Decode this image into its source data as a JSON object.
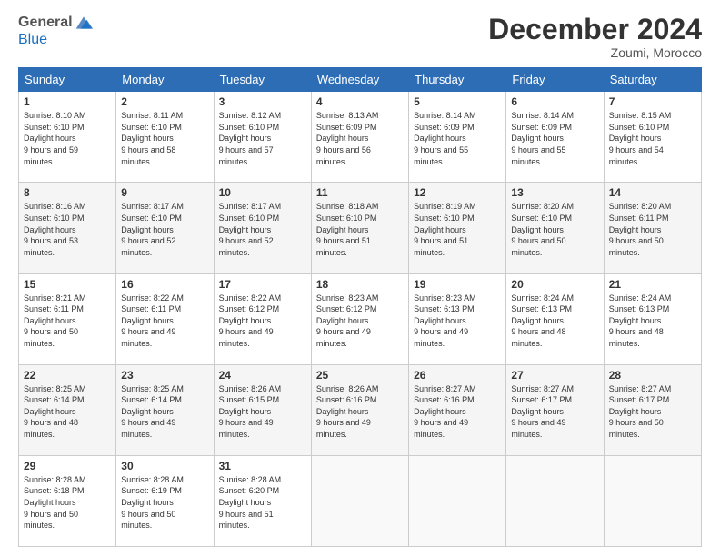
{
  "header": {
    "logo_general": "General",
    "logo_blue": "Blue",
    "month_title": "December 2024",
    "location": "Zoumi, Morocco"
  },
  "weekdays": [
    "Sunday",
    "Monday",
    "Tuesday",
    "Wednesday",
    "Thursday",
    "Friday",
    "Saturday"
  ],
  "weeks": [
    [
      {
        "day": "1",
        "sunrise": "8:10 AM",
        "sunset": "6:10 PM",
        "daylight": "9 hours and 59 minutes."
      },
      {
        "day": "2",
        "sunrise": "8:11 AM",
        "sunset": "6:10 PM",
        "daylight": "9 hours and 58 minutes."
      },
      {
        "day": "3",
        "sunrise": "8:12 AM",
        "sunset": "6:10 PM",
        "daylight": "9 hours and 57 minutes."
      },
      {
        "day": "4",
        "sunrise": "8:13 AM",
        "sunset": "6:09 PM",
        "daylight": "9 hours and 56 minutes."
      },
      {
        "day": "5",
        "sunrise": "8:14 AM",
        "sunset": "6:09 PM",
        "daylight": "9 hours and 55 minutes."
      },
      {
        "day": "6",
        "sunrise": "8:14 AM",
        "sunset": "6:09 PM",
        "daylight": "9 hours and 55 minutes."
      },
      {
        "day": "7",
        "sunrise": "8:15 AM",
        "sunset": "6:10 PM",
        "daylight": "9 hours and 54 minutes."
      }
    ],
    [
      {
        "day": "8",
        "sunrise": "8:16 AM",
        "sunset": "6:10 PM",
        "daylight": "9 hours and 53 minutes."
      },
      {
        "day": "9",
        "sunrise": "8:17 AM",
        "sunset": "6:10 PM",
        "daylight": "9 hours and 52 minutes."
      },
      {
        "day": "10",
        "sunrise": "8:17 AM",
        "sunset": "6:10 PM",
        "daylight": "9 hours and 52 minutes."
      },
      {
        "day": "11",
        "sunrise": "8:18 AM",
        "sunset": "6:10 PM",
        "daylight": "9 hours and 51 minutes."
      },
      {
        "day": "12",
        "sunrise": "8:19 AM",
        "sunset": "6:10 PM",
        "daylight": "9 hours and 51 minutes."
      },
      {
        "day": "13",
        "sunrise": "8:20 AM",
        "sunset": "6:10 PM",
        "daylight": "9 hours and 50 minutes."
      },
      {
        "day": "14",
        "sunrise": "8:20 AM",
        "sunset": "6:11 PM",
        "daylight": "9 hours and 50 minutes."
      }
    ],
    [
      {
        "day": "15",
        "sunrise": "8:21 AM",
        "sunset": "6:11 PM",
        "daylight": "9 hours and 50 minutes."
      },
      {
        "day": "16",
        "sunrise": "8:22 AM",
        "sunset": "6:11 PM",
        "daylight": "9 hours and 49 minutes."
      },
      {
        "day": "17",
        "sunrise": "8:22 AM",
        "sunset": "6:12 PM",
        "daylight": "9 hours and 49 minutes."
      },
      {
        "day": "18",
        "sunrise": "8:23 AM",
        "sunset": "6:12 PM",
        "daylight": "9 hours and 49 minutes."
      },
      {
        "day": "19",
        "sunrise": "8:23 AM",
        "sunset": "6:13 PM",
        "daylight": "9 hours and 49 minutes."
      },
      {
        "day": "20",
        "sunrise": "8:24 AM",
        "sunset": "6:13 PM",
        "daylight": "9 hours and 48 minutes."
      },
      {
        "day": "21",
        "sunrise": "8:24 AM",
        "sunset": "6:13 PM",
        "daylight": "9 hours and 48 minutes."
      }
    ],
    [
      {
        "day": "22",
        "sunrise": "8:25 AM",
        "sunset": "6:14 PM",
        "daylight": "9 hours and 48 minutes."
      },
      {
        "day": "23",
        "sunrise": "8:25 AM",
        "sunset": "6:14 PM",
        "daylight": "9 hours and 49 minutes."
      },
      {
        "day": "24",
        "sunrise": "8:26 AM",
        "sunset": "6:15 PM",
        "daylight": "9 hours and 49 minutes."
      },
      {
        "day": "25",
        "sunrise": "8:26 AM",
        "sunset": "6:16 PM",
        "daylight": "9 hours and 49 minutes."
      },
      {
        "day": "26",
        "sunrise": "8:27 AM",
        "sunset": "6:16 PM",
        "daylight": "9 hours and 49 minutes."
      },
      {
        "day": "27",
        "sunrise": "8:27 AM",
        "sunset": "6:17 PM",
        "daylight": "9 hours and 49 minutes."
      },
      {
        "day": "28",
        "sunrise": "8:27 AM",
        "sunset": "6:17 PM",
        "daylight": "9 hours and 50 minutes."
      }
    ],
    [
      {
        "day": "29",
        "sunrise": "8:28 AM",
        "sunset": "6:18 PM",
        "daylight": "9 hours and 50 minutes."
      },
      {
        "day": "30",
        "sunrise": "8:28 AM",
        "sunset": "6:19 PM",
        "daylight": "9 hours and 50 minutes."
      },
      {
        "day": "31",
        "sunrise": "8:28 AM",
        "sunset": "6:20 PM",
        "daylight": "9 hours and 51 minutes."
      },
      null,
      null,
      null,
      null
    ]
  ]
}
